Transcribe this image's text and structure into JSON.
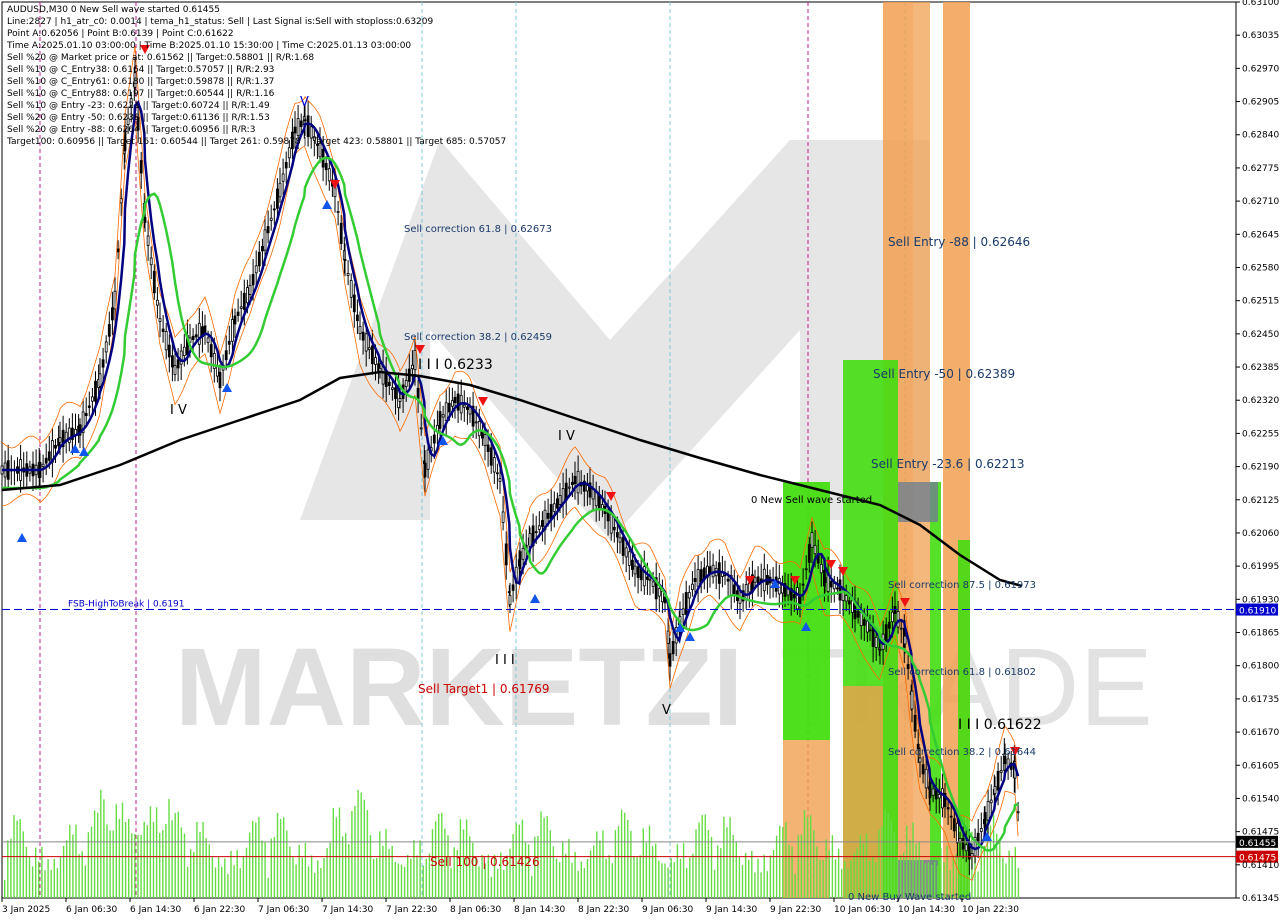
{
  "chart_data": {
    "type": "line",
    "symbol_title": "AUDUSD,M30",
    "title_overlay": "0 New Sell wave started",
    "price_now": "0.61455",
    "info_lines": [
      "Line:2827 | h1_atr_c0: 0.0014 | tema_h1_status: Sell | Last Signal is:Sell with stoploss:0.63209",
      "Point A:0.62056 | Point B:0.6139 | Point C:0.61622",
      "Time A:2025.01.10 03:00:00 | Time B:2025.01.10 15:30:00 | Time C:2025.01.13 03:00:00",
      "Sell %20 @ Market price or at: 0.61562 || Target:0.58801 || R/R:1.68",
      "Sell %10 @ C_Entry38: 0.6164 || Target:0.57057 || R/R:2.93",
      "Sell %10 @ C_Entry61: 0.6180 || Target:0.59878 || R/R:1.37",
      "Sell %10 @ C_Entry88: 0.6197 || Target:0.60544 || R/R:1.16",
      "Sell %10 @ Entry -23: 0.6221 || Target:0.60724 || R/R:1.49",
      "Sell %20 @ Entry -50: 0.6238 || Target:0.61136 || R/R:1.53",
      "Sell %20 @ Entry -88: 0.6264 || Target:0.60956 || R/R:3",
      "Target100: 0.60956 || Target 161: 0.60544 || Target 261: 0.59878 || Target 423: 0.58801 || Target 685: 0.57057"
    ],
    "y_ticks": [
      "0.63100",
      "0.63035",
      "0.62970",
      "0.62905",
      "0.62840",
      "0.62775",
      "0.62710",
      "0.62645",
      "0.62580",
      "0.62515",
      "0.62450",
      "0.62385",
      "0.62320",
      "0.62255",
      "0.62190",
      "0.62125",
      "0.62060",
      "0.61995",
      "0.61930",
      "0.61865",
      "0.61800",
      "0.61735",
      "0.61670",
      "0.61605",
      "0.61540",
      "0.61475",
      "0.61410",
      "0.61345"
    ],
    "ylim": [
      0.61345,
      0.631
    ],
    "x_ticks": [
      "3 Jan 2025",
      "6 Jan 06:30",
      "6 Jan 14:30",
      "6 Jan 22:30",
      "7 Jan 06:30",
      "7 Jan 14:30",
      "7 Jan 22:30",
      "8 Jan 06:30",
      "8 Jan 14:30",
      "8 Jan 22:30",
      "9 Jan 06:30",
      "9 Jan 14:30",
      "9 Jan 22:30",
      "10 Jan 06:30",
      "10 Jan 14:30",
      "10 Jan 22:30"
    ],
    "levels": [
      {
        "label": "FSB-HighToBreak | 0.6191",
        "value": 0.6191,
        "color": "#0000cc",
        "tag": "0.61910"
      },
      {
        "label": "Sell 100 | 0.61426",
        "value": 0.61426,
        "color": "#cc0000",
        "tag": "0.61475"
      }
    ],
    "annotations": [
      {
        "text": "Sell correction 61.8 | 0.62673",
        "color": "#1a3a6b"
      },
      {
        "text": "Sell correction 38.2 | 0.62459",
        "color": "#1a3a6b"
      },
      {
        "text": "I I I 0.6233",
        "color": "#000000"
      },
      {
        "text": "Sell Entry -88 | 0.62646",
        "color": "#1a3a6b"
      },
      {
        "text": "Sell Entry -50 | 0.62389",
        "color": "#1a3a6b"
      },
      {
        "text": "Sell Entry -23.6 | 0.62213",
        "color": "#1a3a6b"
      },
      {
        "text": "0 New Sell wave started",
        "color": "#000000"
      },
      {
        "text": "Sell correction 87.5 | 0.61973",
        "color": "#1a3a6b"
      },
      {
        "text": "Sell correction 61.8 | 0.61802",
        "color": "#1a3a6b"
      },
      {
        "text": "Sell correction 38.2 | 0.61644",
        "color": "#1a3a6b"
      },
      {
        "text": "I I I 0.61622",
        "color": "#000000"
      },
      {
        "text": "Sell Target1 | 0.61769",
        "color": "#cc0000"
      },
      {
        "text": "0 New Buy Wave started",
        "color": "#1a3a6b"
      },
      {
        "text": "I V",
        "color": "#000000"
      },
      {
        "text": "V",
        "color": "#0000cc"
      },
      {
        "text": "I I I",
        "color": "#000000"
      },
      {
        "text": "V",
        "color": "#000000"
      }
    ],
    "watermark": "MARKETZI",
    "colors": {
      "candles": "#000000",
      "ema_fast": "#000080",
      "ema_mid": "#33cc33",
      "ema_slow": "#000000",
      "zone_orange": "#f0a050",
      "zone_green": "#44dd11",
      "volume": "#66dd44"
    }
  }
}
